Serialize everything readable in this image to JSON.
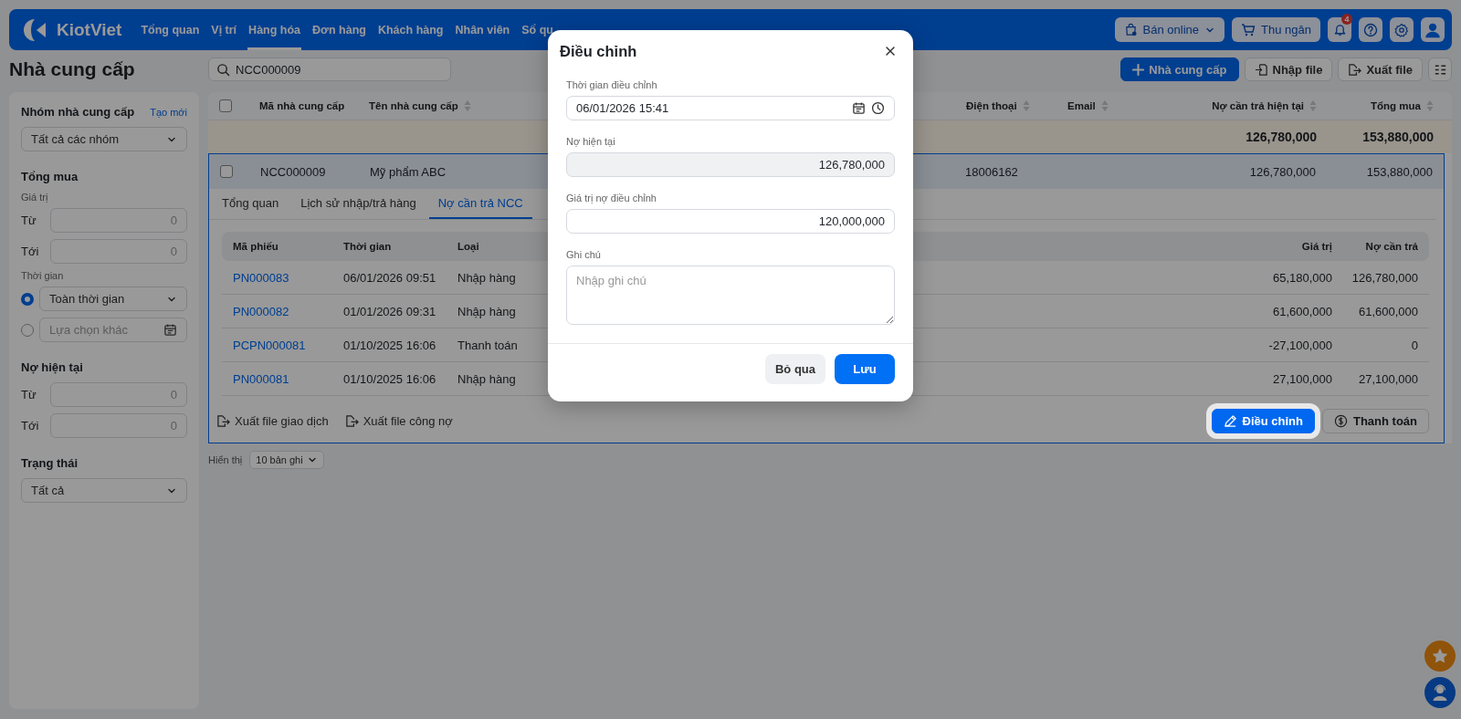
{
  "nav": {
    "logo": "KiotViet",
    "items": [
      {
        "label": "Tổng quan",
        "selected": false
      },
      {
        "label": "Vị trí",
        "selected": false
      },
      {
        "label": "Hàng hóa",
        "selected": true
      },
      {
        "label": "Đơn hàng",
        "selected": false
      },
      {
        "label": "Khách hàng",
        "selected": false
      },
      {
        "label": "Nhân viên",
        "selected": false
      },
      {
        "label": "Sổ qu",
        "selected": false
      }
    ],
    "online_sales": "Bán online",
    "cashier": "Thu ngân",
    "notification_count": "4"
  },
  "page": {
    "title": "Nhà cung cấp",
    "search": {
      "value": "NCC000009"
    },
    "buttons": [
      {
        "kind": "add",
        "label": "Nhà cung cấp"
      },
      {
        "kind": "import",
        "label": "Nhập file"
      },
      {
        "kind": "export",
        "label": "Xuất file"
      },
      {
        "kind": "columns"
      }
    ]
  },
  "sidebar": {
    "sections": [
      {
        "title": "Nhóm nhà cung cấp",
        "link": "Tạo mới",
        "blocks": [
          {
            "kind": "select",
            "value": "Tất cả các nhóm"
          }
        ]
      },
      {
        "title": "Tổng mua",
        "blocks": [
          {
            "kind": "label",
            "text": "Giá trị"
          },
          {
            "kind": "range",
            "label": "Từ",
            "placeholder": "0"
          },
          {
            "kind": "range",
            "label": "Tới",
            "placeholder": "0"
          },
          {
            "kind": "label",
            "text": "Thời gian"
          },
          {
            "kind": "radio-select",
            "selected": true,
            "value": "Toàn thời gian"
          },
          {
            "kind": "radio-date",
            "selected": false,
            "placeholder": "Lựa chọn khác"
          }
        ]
      },
      {
        "title": "Nợ hiện tại",
        "blocks": [
          {
            "kind": "range",
            "label": "Từ",
            "placeholder": "0"
          },
          {
            "kind": "range",
            "label": "Tới",
            "placeholder": "0"
          }
        ]
      },
      {
        "title": "Trạng thái",
        "blocks": [
          {
            "kind": "select",
            "value": "Tất cả"
          }
        ]
      }
    ]
  },
  "table": {
    "all_checked": false,
    "columns": [
      {
        "label": "Mã nhà cung cấp"
      },
      {
        "label": "Tên nhà cung cấp"
      },
      {
        "label": "Điện thoại"
      },
      {
        "label": "Email"
      },
      {
        "label": "Nợ cần trả hiện tại"
      },
      {
        "label": "Tổng mua"
      }
    ],
    "summary": {
      "debt": "126,780,000",
      "total": "153,880,000"
    },
    "rows": [
      {
        "selected": true,
        "checked": false,
        "expanded": true,
        "code": "NCC000009",
        "name": "Mỹ phẩm ABC",
        "phone": "18006162",
        "debt": "126,780,000",
        "total": "153,880,000",
        "detail": {
          "tabs": [
            {
              "label": "Tổng quan",
              "selected": false
            },
            {
              "label": "Lịch sử nhập/trả hàng",
              "selected": false
            },
            {
              "label": "Nợ cần trả NCC",
              "selected": true
            }
          ],
          "columns": [
            {
              "label": "Mã phiếu"
            },
            {
              "label": "Thời gian"
            },
            {
              "label": "Loại"
            },
            {
              "label": "Giá trị"
            },
            {
              "label": "Nợ cần trả"
            }
          ],
          "rows": [
            {
              "code": "PN000083",
              "time": "06/01/2026 09:51",
              "type": "Nhập hàng",
              "value": "65,180,000",
              "balance": "126,780,000"
            },
            {
              "code": "PN000082",
              "time": "01/01/2026 09:31",
              "type": "Nhập hàng",
              "value": "61,600,000",
              "balance": "61,600,000"
            },
            {
              "code": "PCPN000081",
              "time": "01/10/2025 16:06",
              "type": "Thanh toán",
              "value": "-27,100,000",
              "balance": "0"
            },
            {
              "code": "PN000081",
              "time": "01/10/2025 16:06",
              "type": "Nhập hàng",
              "value": "27,100,000",
              "balance": "27,100,000"
            }
          ],
          "links": [
            "Xuất file giao dịch",
            "Xuất file công nợ"
          ],
          "actions": [
            {
              "kind": "adjust",
              "label": "Điều chỉnh",
              "spotlight": true
            },
            {
              "kind": "pay",
              "label": "Thanh toán",
              "spotlight": false
            }
          ]
        }
      }
    ]
  },
  "pagination": {
    "label": "Hiển thị",
    "page_size": "10 bản ghi"
  },
  "dialog": {
    "title": "Điều chỉnh",
    "fields": [
      {
        "kind": "datetime",
        "label": "Thời gian điều chỉnh",
        "value": "06/01/2026 15:41"
      },
      {
        "kind": "readonly",
        "label": "Nợ hiện tại",
        "value": "126,780,000"
      },
      {
        "kind": "number",
        "label": "Giá trị nợ điều chỉnh",
        "value": "120,000,000"
      },
      {
        "kind": "textarea",
        "label": "Ghi chú",
        "placeholder": "Nhập ghi chú"
      }
    ],
    "buttons": [
      {
        "kind": "secondary",
        "label": "Bỏ qua"
      },
      {
        "kind": "primary",
        "label": "Lưu"
      }
    ]
  }
}
